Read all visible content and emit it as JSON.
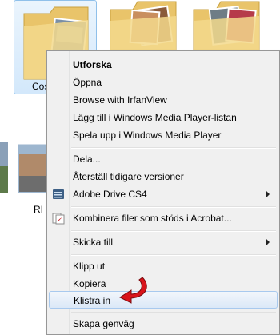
{
  "explorer": {
    "selected_folder_label": "Cos",
    "file_label_partial": "RI"
  },
  "context_menu": {
    "items": [
      {
        "label": "Utforska"
      },
      {
        "label": "Öppna"
      },
      {
        "label": "Browse with IrfanView"
      },
      {
        "label": "Lägg till i Windows Media Player-listan"
      },
      {
        "label": "Spela upp i Windows Media Player"
      },
      {
        "label": "Dela..."
      },
      {
        "label": "Återställ tidigare versioner"
      },
      {
        "label": "Adobe Drive CS4"
      },
      {
        "label": "Kombinera filer som stöds i Acrobat..."
      },
      {
        "label": "Skicka till"
      },
      {
        "label": "Klipp ut"
      },
      {
        "label": "Kopiera"
      },
      {
        "label": "Klistra in"
      },
      {
        "label": "Skapa genväg"
      }
    ]
  },
  "colors": {
    "menu_bg": "#f0f0f0",
    "hover_border": "#a8c9ee",
    "pointer_arrow": "#d9141b"
  }
}
